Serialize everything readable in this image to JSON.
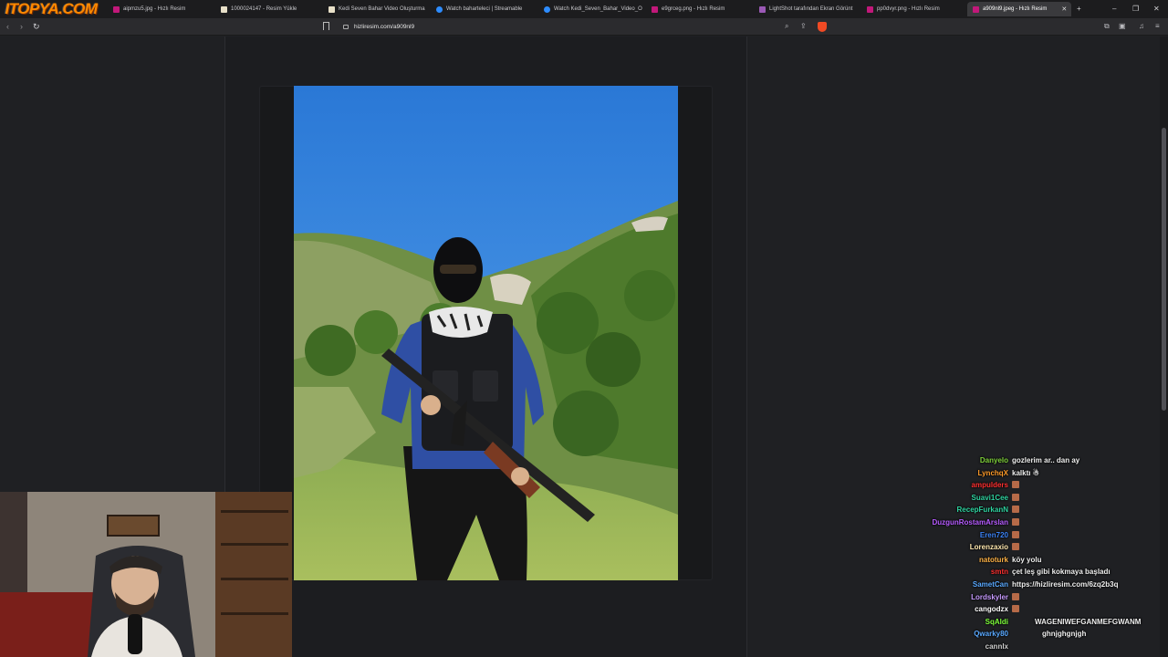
{
  "watermark": "ITOPYA.COM",
  "tabs": [
    {
      "label": "aipmzu5.jpg - Hızlı Resim",
      "favicon_color": "#c2187a"
    },
    {
      "label": "1000024147 - Resim Yükle",
      "favicon_color": "#e8e0c8"
    },
    {
      "label": "Kedi Seven Bahar Video Oluşturma",
      "favicon_color": "#e8e0c8"
    },
    {
      "label": "Watch baharteleci | Streamable",
      "favicon_color": "#2d8cff"
    },
    {
      "label": "Watch Kedi_Seven_Bahar_Video_O",
      "favicon_color": "#2d8cff"
    },
    {
      "label": "e9grceg.png - Hızlı Resim",
      "favicon_color": "#c2187a"
    },
    {
      "label": "LightShot tarafından Ekran Görünt",
      "favicon_color": "#9b59b6"
    },
    {
      "label": "pp0dvyr.png - Hızlı Resim",
      "favicon_color": "#c2187a"
    },
    {
      "label": "a909nl9.jpeg - Hızlı Resim",
      "favicon_color": "#c2187a",
      "active": true
    }
  ],
  "new_tab": "+",
  "window_controls": {
    "minimize": "–",
    "maximize": "❐",
    "close": "✕"
  },
  "address_bar": {
    "url": "hizliresim.com/a909nl9"
  },
  "chat": {
    "messages": [
      {
        "user": "Danyelo",
        "text": "gozlerim ar.. dan ay",
        "color": "#7fd13b",
        "emote": false
      },
      {
        "user": "LynchqX",
        "text": "kalktı ☃",
        "color": "#ff9b29",
        "emote": false
      },
      {
        "user": "ampulders",
        "text": "",
        "color": "#ff3030",
        "emote": true
      },
      {
        "user": "Suavi1Cee",
        "text": "",
        "color": "#2fd3a0",
        "emote": true
      },
      {
        "user": "RecepFurkanN",
        "text": "",
        "color": "#2fd3a0",
        "emote": true
      },
      {
        "user": "DuzgunRostamArslan",
        "text": "",
        "color": "#b65cff",
        "emote": true
      },
      {
        "user": "Eren720",
        "text": "",
        "color": "#3b82f6",
        "emote": true
      },
      {
        "user": "Lorenzaxio",
        "text": "",
        "color": "#ffe8b0",
        "emote": true
      },
      {
        "user": "natoturk",
        "text": "köy yolu",
        "color": "#ffb347",
        "emote": false
      },
      {
        "user": "smtn",
        "text": "çet leş gibi kokmaya başladı",
        "color": "#ff3030",
        "emote": false
      },
      {
        "user": "SametCan",
        "text": "https://hizliresim.com/6zq2b3q",
        "color": "#5aa9ff",
        "emote": false
      },
      {
        "user": "Lordskyler",
        "text": "",
        "color": "#c79bff",
        "emote": true
      },
      {
        "user": "cangodzx",
        "text": "",
        "color": "#ffffff",
        "emote": true
      },
      {
        "user": "SqAldi",
        "text": "WAGENIWEFGANMEFGWANM",
        "color": "#7fff3b",
        "emote": false
      },
      {
        "user": "Qwarky80",
        "text": "ghnjghgnjgh",
        "color": "#5aa9ff",
        "emote": false
      },
      {
        "user": "cannlx",
        "text": "",
        "color": "#cfcfcf",
        "emote": false
      }
    ]
  },
  "colors": {
    "background": "#1f2023",
    "tab_active": "#3a3a3d",
    "sky": "#2e86e0",
    "hills": "#5f8a3a"
  },
  "icons": [
    "back-icon",
    "forward-icon",
    "reload-icon",
    "bookmark-icon",
    "lock-icon",
    "zoom-icon",
    "share-icon",
    "brave-shield-icon",
    "extensions-icon",
    "sidebar-icon",
    "menu-icon"
  ]
}
